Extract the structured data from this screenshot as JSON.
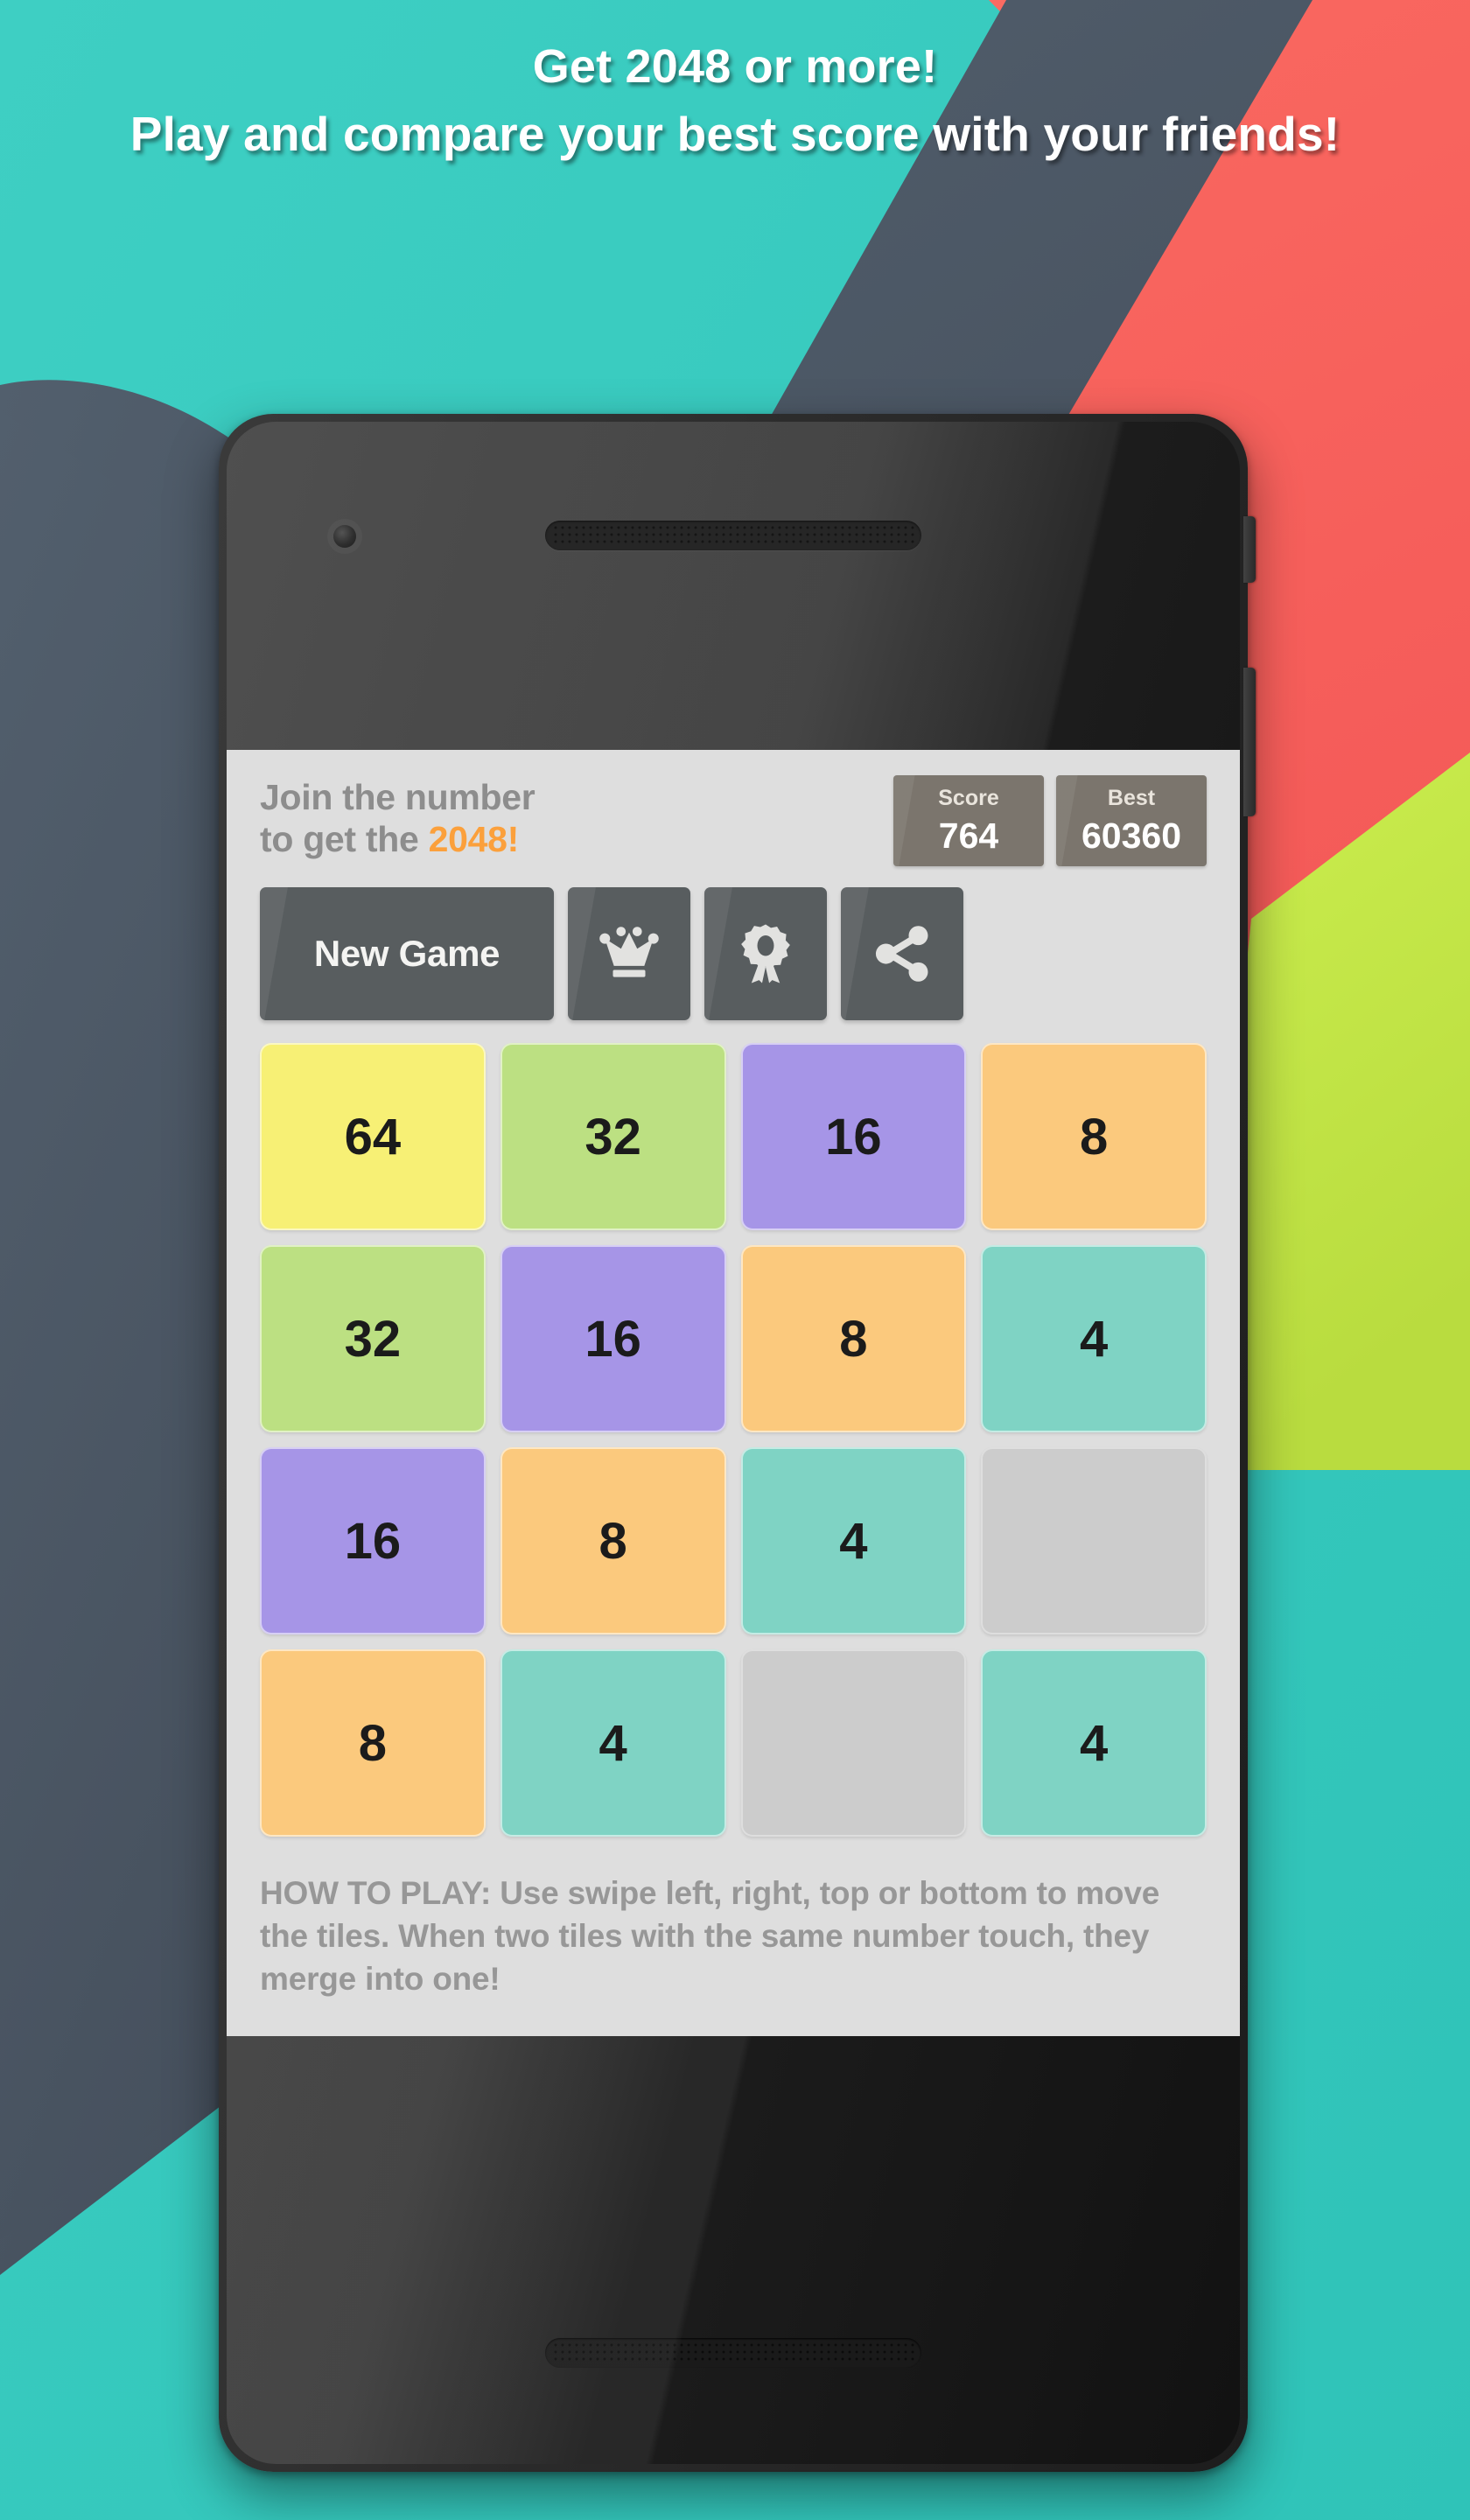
{
  "promo": {
    "headline_line1": "Get 2048 or more!",
    "headline_line2": "Play and compare your best score with your friends!",
    "bg_colors": {
      "teal": "#3BCCC0",
      "slate": "#4E5B68",
      "coral": "#F9645F",
      "lime": "#C5E84B"
    }
  },
  "app": {
    "title_line1": "Join the number",
    "title_line2_prefix": "to get the ",
    "title_highlight": "2048!",
    "title_highlight_color": "#FBA03C",
    "scores": [
      {
        "label": "Score",
        "value": "764"
      },
      {
        "label": "Best",
        "value": "60360"
      }
    ],
    "buttons": [
      {
        "name": "new-game",
        "label": "New Game",
        "icon": null
      },
      {
        "name": "leaderboard",
        "label": "",
        "icon": "crown-icon"
      },
      {
        "name": "achievements",
        "label": "",
        "icon": "award-ribbon-icon"
      },
      {
        "name": "share",
        "label": "",
        "icon": "share-icon"
      }
    ],
    "board": {
      "rows": [
        [
          {
            "value": "64",
            "color": "#F7F075"
          },
          {
            "value": "32",
            "color": "#BCE082"
          },
          {
            "value": "16",
            "color": "#A695E7"
          },
          {
            "value": "8",
            "color": "#FBC97D"
          }
        ],
        [
          {
            "value": "32",
            "color": "#BCE082"
          },
          {
            "value": "16",
            "color": "#A695E7"
          },
          {
            "value": "8",
            "color": "#FBC97D"
          },
          {
            "value": "4",
            "color": "#7FD3C4"
          }
        ],
        [
          {
            "value": "16",
            "color": "#A695E7"
          },
          {
            "value": "8",
            "color": "#FBC97D"
          },
          {
            "value": "4",
            "color": "#7FD3C4"
          },
          {
            "value": "",
            "color": "#CCCCCC"
          }
        ],
        [
          {
            "value": "8",
            "color": "#FBC97D"
          },
          {
            "value": "4",
            "color": "#7FD3C4"
          },
          {
            "value": "",
            "color": "#CCCCCC"
          },
          {
            "value": "4",
            "color": "#7FD3C4"
          }
        ]
      ]
    },
    "how_to_play": "HOW TO PLAY: Use swipe left, right, top or bottom to move the tiles. When two tiles with the same number touch, they merge into one!"
  }
}
